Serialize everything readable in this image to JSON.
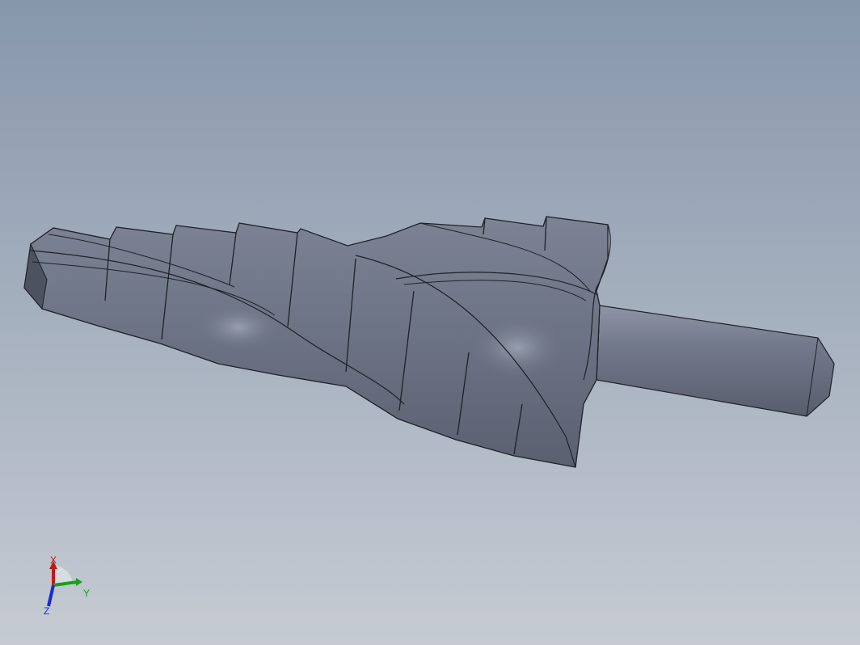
{
  "viewport": {
    "background_top": "#8797ab",
    "background_bottom": "#c6cbd3"
  },
  "model": {
    "name": "step-drill-bit",
    "body_color": "#6b7283",
    "edge_color": "#1e2128"
  },
  "triad": {
    "x_label": "X",
    "y_label": "Y",
    "z_label": "Z",
    "x_color": "#c01818",
    "y_color": "#18a018",
    "z_color": "#1a2ad0"
  }
}
